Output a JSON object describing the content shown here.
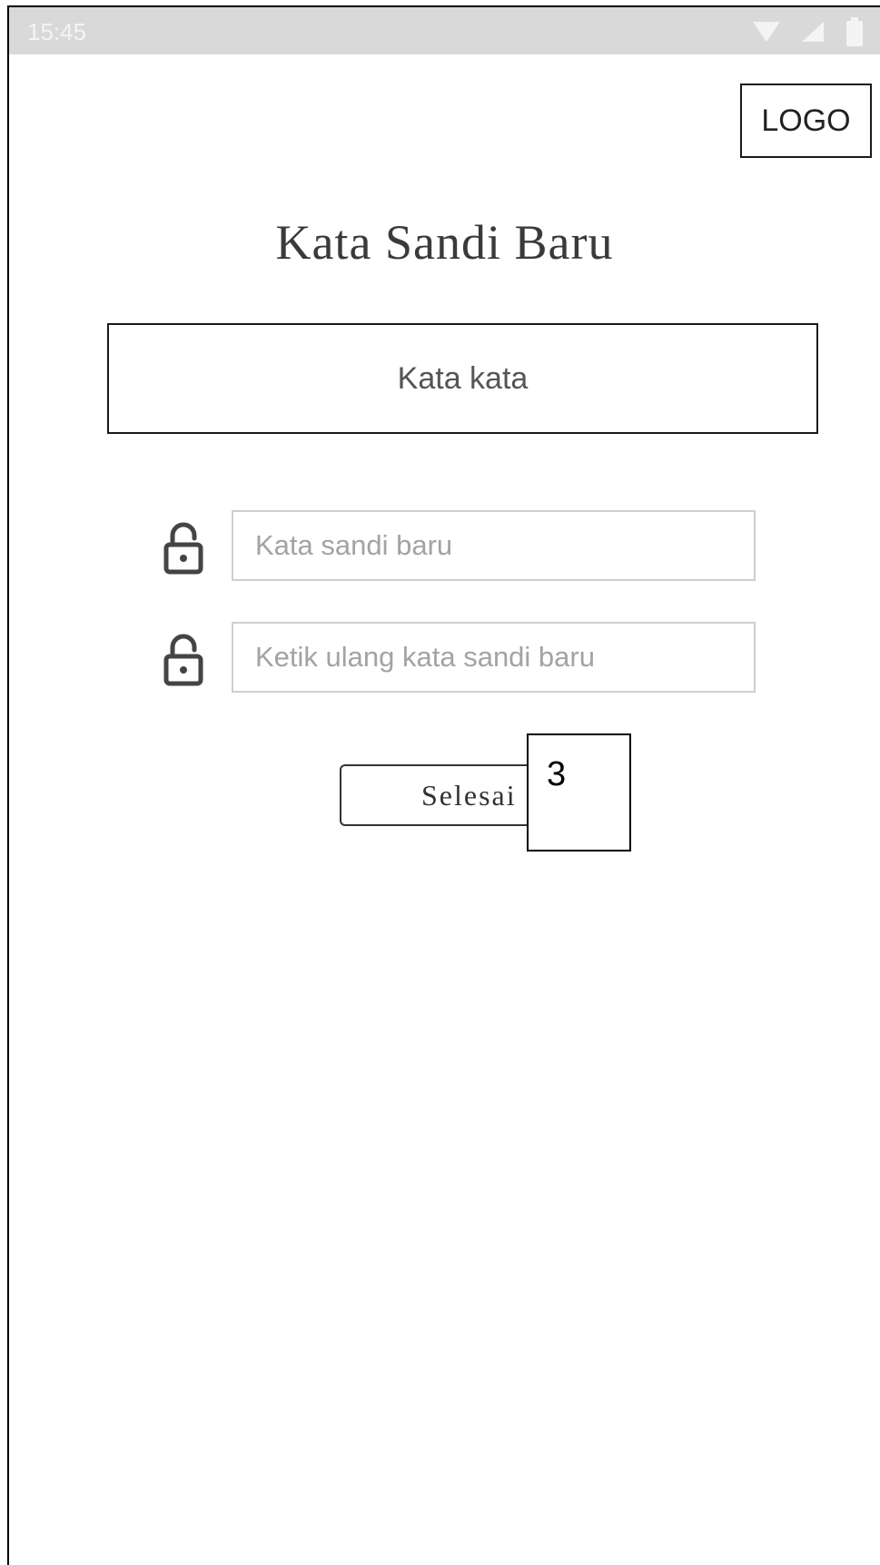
{
  "status_bar": {
    "time": "15:45",
    "icons": [
      "wifi-icon",
      "signal-icon",
      "battery-icon"
    ]
  },
  "logo": {
    "label": "LOGO"
  },
  "page": {
    "title": "Kata Sandi Baru",
    "info_text": "Kata kata"
  },
  "form": {
    "new_password": {
      "placeholder": "Kata sandi baru",
      "icon": "lock-open-icon"
    },
    "confirm_password": {
      "placeholder": "Ketik ulang kata sandi baru",
      "icon": "lock-open-icon"
    },
    "done_label": "Selesai"
  },
  "annotation": {
    "label": "3"
  },
  "colors": {
    "status_bar_bg": "#d9d9d9",
    "border": "#1a1a1a",
    "placeholder": "#a3a3a3"
  }
}
